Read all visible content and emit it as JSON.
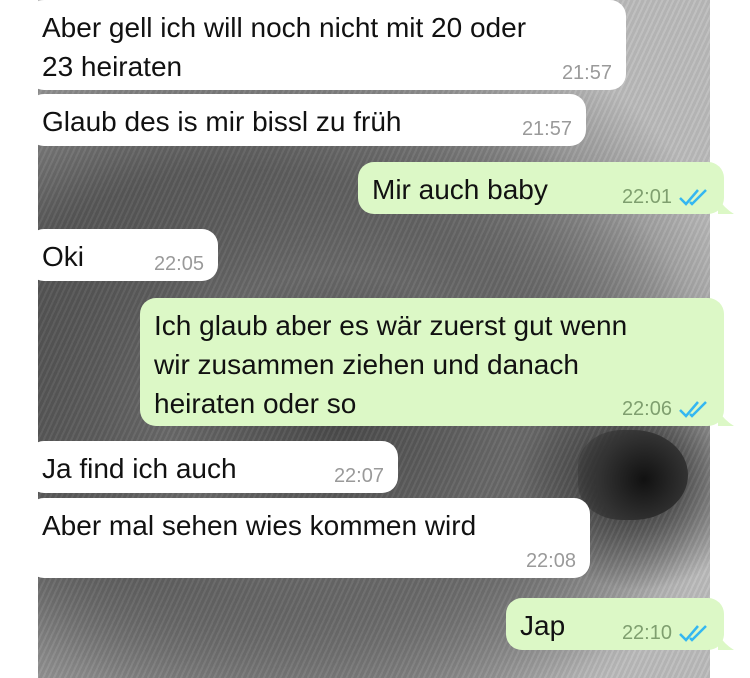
{
  "messages": [
    {
      "dir": "in",
      "text": "Aber gell ich will noch nicht mit 20 oder\n23 heiraten",
      "time": "21:57"
    },
    {
      "dir": "in",
      "text": "Glaub des is mir bissl zu früh",
      "time": "21:57"
    },
    {
      "dir": "out",
      "text": "Mir auch baby",
      "time": "22:01",
      "read": true
    },
    {
      "dir": "in",
      "text": "Oki",
      "time": "22:05"
    },
    {
      "dir": "out",
      "text": "Ich glaub aber es wär zuerst gut wenn\nwir zusammen ziehen und danach\nheiraten oder so",
      "time": "22:06",
      "read": true
    },
    {
      "dir": "in",
      "text": "Ja find ich auch",
      "time": "22:07"
    },
    {
      "dir": "in",
      "text": "Aber mal sehen wies kommen wird",
      "time": "22:08"
    },
    {
      "dir": "out",
      "text": "Jap",
      "time": "22:10",
      "read": true
    }
  ],
  "colors": {
    "incoming_bubble": "#ffffff",
    "outgoing_bubble": "#dcf8c6",
    "read_ticks": "#34b7f1",
    "timestamp": "#9a9a9a"
  },
  "icons": {
    "read_receipt": "double-check-icon"
  }
}
